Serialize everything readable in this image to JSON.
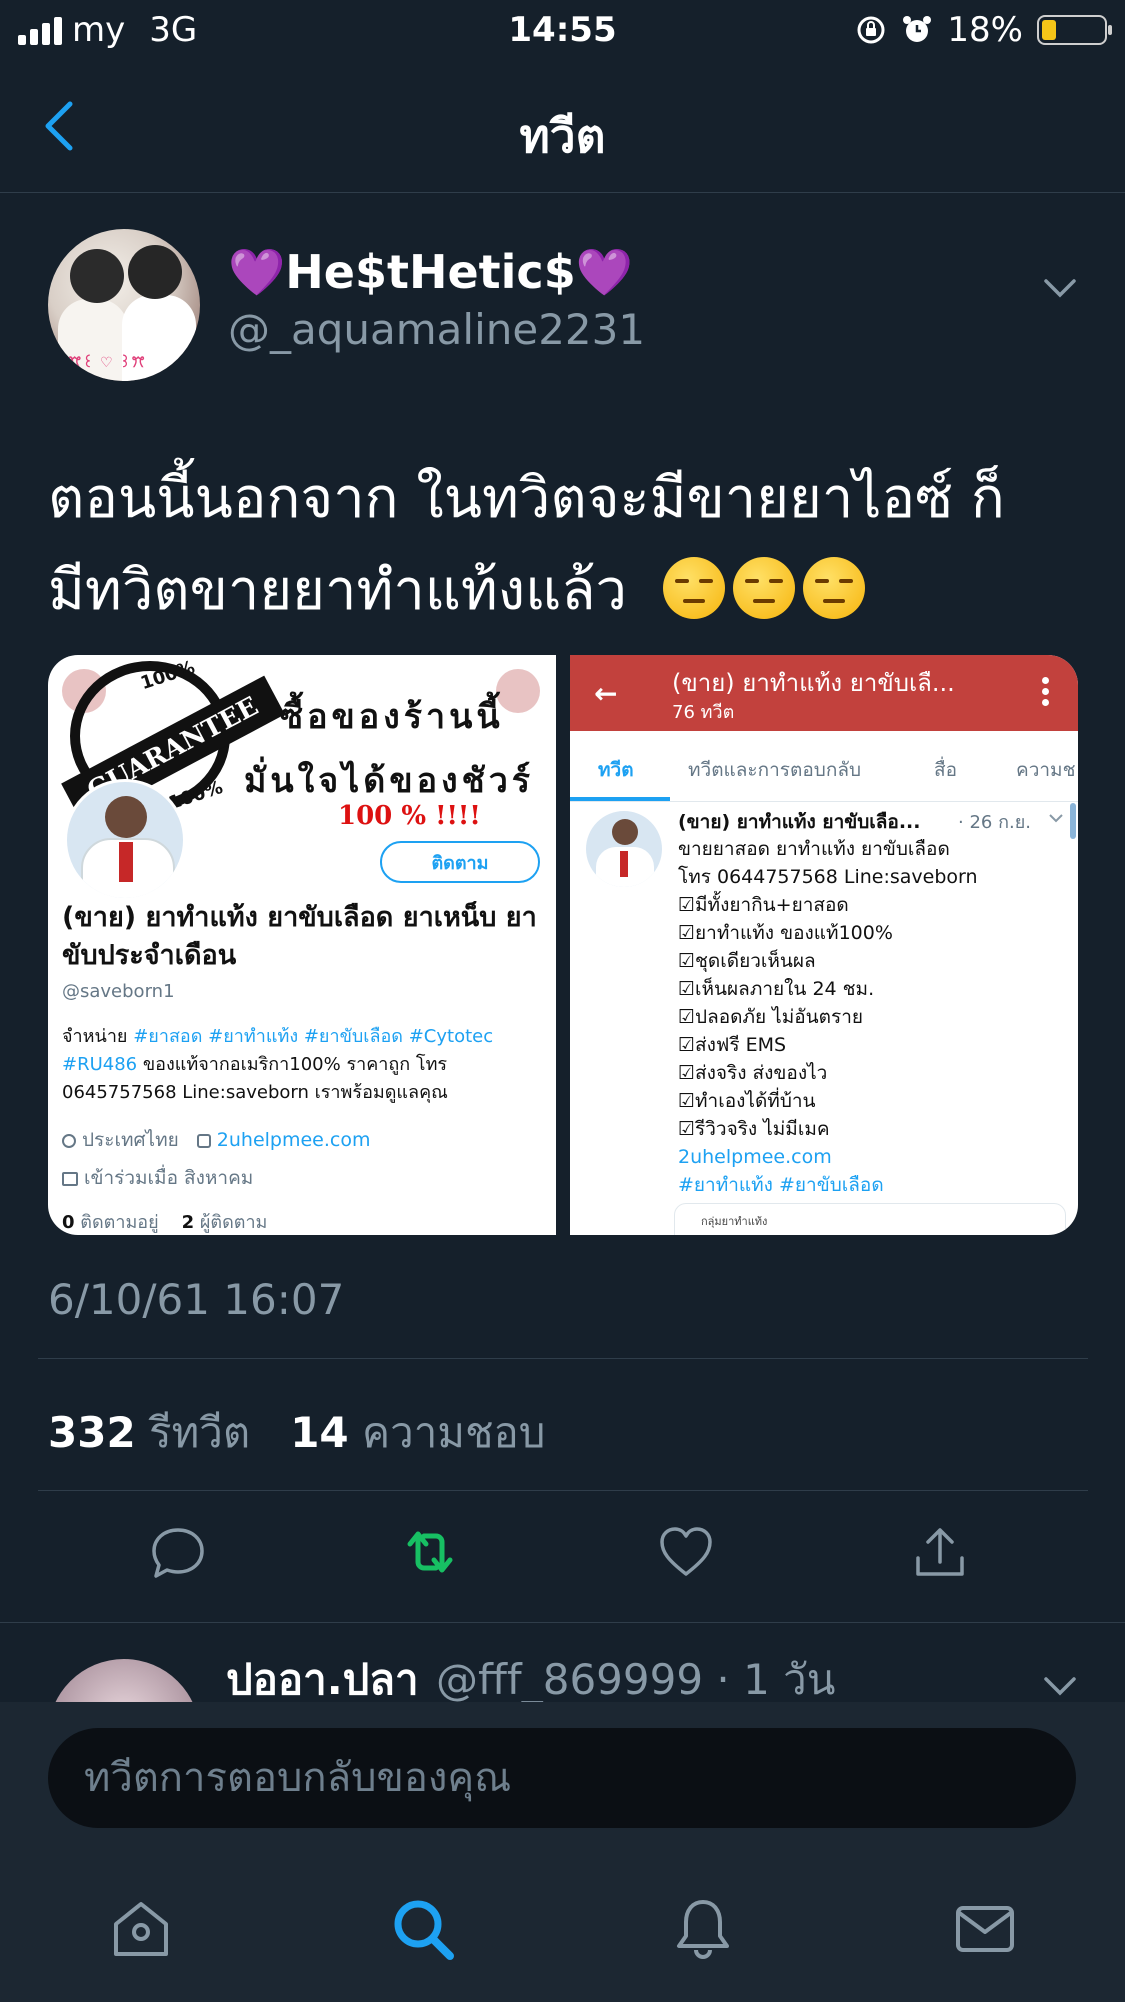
{
  "status_bar": {
    "carrier": "my",
    "network": "3G",
    "time": "14:55",
    "battery": "18%",
    "battery_level": 0.18,
    "battery_color": "#f5c518"
  },
  "header": {
    "back_icon": "chevron-left-icon",
    "title": "ทวีต"
  },
  "tweet": {
    "display_name": "💜He$tHetic$💜",
    "handle": "@_aquamaline2231",
    "avatar_caption": "ꔫ꒰ ♡ ꒱ꔫ",
    "text_line1": "ตอนนี้นอกจาก ในทวิตจะมีขายยาไอซ์ ก็",
    "text_line2": "มีทวิตขายยาทำแท้งแล้ว",
    "emojis": [
      "😒",
      "😒",
      "😒"
    ],
    "timestamp": "6/10/61 16:07",
    "retweets": "332",
    "retweets_label": "รีทวีต",
    "likes": "14",
    "likes_label": "ความชอบ",
    "accent_retweet": "#17bf63"
  },
  "media_left": {
    "stamp_top": "100%",
    "stamp_band": "GUARANTEE",
    "stamp_bottom": "100%",
    "promo_line1": "ซื้อของร้านนี้",
    "promo_line2": "มั่นใจได้ของชัวร์",
    "promo_line3": "100 % !!!!",
    "follow_label": "ติดตาม",
    "name": "(ขาย) ยาทำแท้ง  ยาขับเลือด ยาเหน็บ ยาขับประจำเดือน",
    "handle": "@saveborn1",
    "bio_prefix": "จำหน่าย ",
    "bio_tags": "#ยาสอด #ยาทำแท้ง #ยาขับเลือด #Cytotec #RU486",
    "bio_rest": " ของแท้จากอเมริกา100% ราคาถูก โทร 0645757568 Line:saveborn เราพร้อมดูแลคุณ",
    "location": "ประเทศไทย",
    "link": "2uhelpmee.com",
    "joined": "เข้าร่วมเมื่อ สิงหาคม",
    "following_count": "0",
    "following_label": "ติดตามอยู่",
    "followers_count": "2",
    "followers_label": "ผู้ติดตาม"
  },
  "media_right": {
    "header_title": "(ขาย) ยาทำแท้ง  ยาขับเลื...",
    "header_count": "76 ทวีต",
    "header_color": "#c2413d",
    "tabs": [
      "ทวีต",
      "ทวีตและการตอบกลับ",
      "สื่อ",
      "ความช"
    ],
    "tweet_name": "(ขาย) ยาทำแท้ง  ยาขับเลือ...",
    "tweet_date": "· 26 ก.ย.",
    "lines": [
      "ขายยาสอด ยาทำแท้ง ยาขับเลือด",
      "โทร 0644757568 Line:saveborn",
      "☑มีทั้งยากิน+ยาสอด",
      "☑ยาทำแท้ง ของแท้100%",
      "☑ชุดเดียวเห็นผล",
      "☑เห็นผลภายใน 24 ชม.",
      "☑ปลอดภัย ไม่อันตราย",
      "☑ส่งฟรี EMS",
      "☑ส่งจริง ส่งของไว",
      "☑ทำเองได้ที่บ้าน",
      "☑รีวิวจริง ไม่มีเมค"
    ],
    "link": "2uhelpmee.com",
    "tags": "#ยาทำแท้ง #ยาขับเลือด",
    "card_caption": "กลุ่มยาทำแท้ง"
  },
  "reply": {
    "name": "ปออา.ปลา",
    "handle_time": "@fff_869999 · 1 วัน"
  },
  "compose": {
    "placeholder": "ทวีตการตอบกลับของคุณ"
  },
  "tabbar": {
    "items": [
      "home-icon",
      "search-icon",
      "notifications-icon",
      "messages-icon"
    ],
    "active_color": "#1da1f2"
  }
}
